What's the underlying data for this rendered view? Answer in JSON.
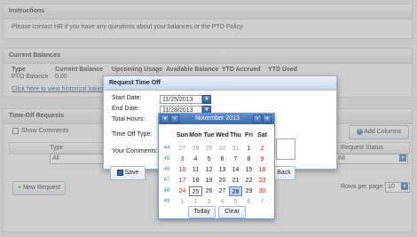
{
  "instructions": {
    "title": "Instructions",
    "text": "Please contact HR if you have any questions about your balances or the PTO Policy."
  },
  "balances": {
    "title": "Current Balances",
    "columns": [
      "Type",
      "Current Balance",
      "Upcoming Usage",
      "Available Balance",
      "YTD Accrued",
      "YTD Used"
    ],
    "row": [
      "PTO Balance",
      "0.00"
    ],
    "history_link": "Click here to view historical balances"
  },
  "timeoff": {
    "title": "Time-Off Requests",
    "show_comments": "Show Comments",
    "add_columns": "Add Columns",
    "col_type": "Type",
    "col_status": "Request Status",
    "filter_all_left": "All",
    "filter_all_right": "All",
    "new_request": "New Request",
    "rows_per_page_label": "Rows per page:",
    "rows_per_page_value": "10"
  },
  "dialog": {
    "title": "Request Time Off",
    "start_label": "Start Date:",
    "start_value": "11/25/2013",
    "end_label": "End Date:",
    "end_value": "11/28/2013",
    "total_hours_label": "Total Hours:",
    "type_label": "Time Off Type:",
    "comments_label": "Your Comments:",
    "save_label": "Save",
    "back_label": "Back"
  },
  "calendar": {
    "month_title": "November 2013",
    "prev_year": "«",
    "prev_month": "‹",
    "next_month": "›",
    "next_year": "»",
    "days_of_week": [
      "Sun",
      "Mon",
      "Tue",
      "Wed",
      "Thu",
      "Fri",
      "Sat"
    ],
    "weeks": [
      {
        "week": "44",
        "days": [
          "27",
          "28",
          "29",
          "30",
          "31",
          "1",
          "2"
        ]
      },
      {
        "week": "45",
        "days": [
          "3",
          "4",
          "5",
          "6",
          "7",
          "8",
          "9"
        ]
      },
      {
        "week": "46",
        "days": [
          "10",
          "11",
          "12",
          "13",
          "14",
          "15",
          "16"
        ]
      },
      {
        "week": "47",
        "days": [
          "17",
          "18",
          "19",
          "20",
          "21",
          "22",
          "23"
        ]
      },
      {
        "week": "48",
        "days": [
          "24",
          "25",
          "26",
          "27",
          "28",
          "29",
          "30"
        ]
      },
      {
        "week": "49",
        "days": [
          "1",
          "2",
          "3",
          "4",
          "5",
          "6",
          "7"
        ]
      }
    ],
    "today_label": "Today",
    "clear_label": "Clear",
    "colors": {
      "header": "#3b6bb0",
      "weekend": "#cf2a1c",
      "selected": "#bcd3ef"
    }
  }
}
